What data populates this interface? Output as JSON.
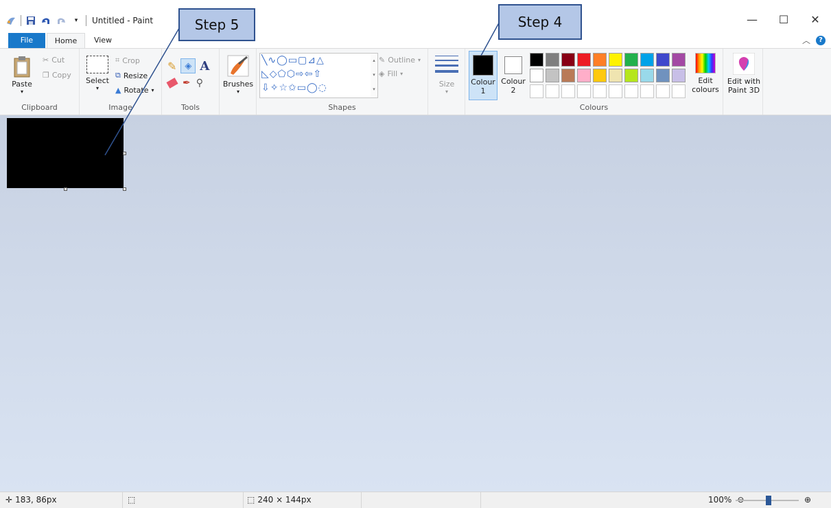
{
  "window": {
    "title": "Untitled - Paint",
    "minimize": "—",
    "maximize": "☐",
    "close": "✕"
  },
  "tabs": [
    {
      "label": "File"
    },
    {
      "label": "Home"
    },
    {
      "label": "View"
    }
  ],
  "clipboard": {
    "paste": "Paste",
    "cut": "Cut",
    "copy": "Copy",
    "label": "Clipboard"
  },
  "image": {
    "select": "Select",
    "crop": "Crop",
    "resize": "Resize",
    "rotate": "Rotate",
    "label": "Image"
  },
  "tools": {
    "label": "Tools"
  },
  "brushes": {
    "label": "Brushes"
  },
  "shapes": {
    "outline": "Outline",
    "fill": "Fill",
    "label": "Shapes"
  },
  "size": {
    "label": "Size"
  },
  "colours": {
    "colour1": "Colour",
    "colour1_num": "1",
    "colour2": "Colour",
    "colour2_num": "2",
    "edit": "Edit",
    "edit2": "colours",
    "label": "Colours",
    "colour1_value": "#000000",
    "colour2_value": "#ffffff",
    "palette_row1": [
      "#000000",
      "#7f7f7f",
      "#880015",
      "#ed1c24",
      "#ff7f27",
      "#fff200",
      "#22b14c",
      "#00a2e8",
      "#3f48cc",
      "#a349a4"
    ],
    "palette_row2": [
      "#ffffff",
      "#c3c3c3",
      "#b97a57",
      "#ffaec9",
      "#ffc90e",
      "#efe4b0",
      "#b5e61d",
      "#99d9ea",
      "#7092be",
      "#c8bfe7"
    ]
  },
  "paint3d": {
    "line1": "Edit with",
    "line2": "Paint 3D"
  },
  "status": {
    "cursor": "183, 86px",
    "size": "240 × 144px",
    "zoom": "100%",
    "zoom_fraction": 0.5
  },
  "callouts": {
    "step5": "Step 5",
    "step4": "Step 4"
  }
}
